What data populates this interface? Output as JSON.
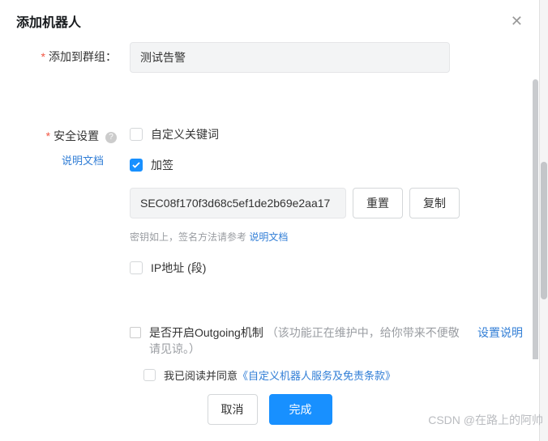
{
  "modal": {
    "title": "添加机器人"
  },
  "group": {
    "label": "添加到群组：",
    "value": "测试告警"
  },
  "security": {
    "label": "安全设置",
    "doc_link": "说明文档",
    "custom_keyword": {
      "label": "自定义关键词",
      "checked": false
    },
    "sign": {
      "label": "加签",
      "checked": true,
      "secret": "SEC08f170f3d68c5ef1de2b69e2aa17",
      "reset": "重置",
      "copy": "复制",
      "hint_prefix": "密钥如上，签名方法请参考 ",
      "hint_link": "说明文档"
    },
    "ip": {
      "label": "IP地址 (段)",
      "checked": false
    }
  },
  "outgoing": {
    "title": "是否开启Outgoing机制",
    "note": "（该功能正在维护中，给你带来不便敬请见谅。）",
    "link": "设置说明"
  },
  "footer": {
    "agree_prefix": "我已阅读并同意",
    "agree_link": "《自定义机器人服务及免责条款》",
    "cancel": "取消",
    "confirm": "完成"
  },
  "watermark": "CSDN @在路上的阿帅"
}
